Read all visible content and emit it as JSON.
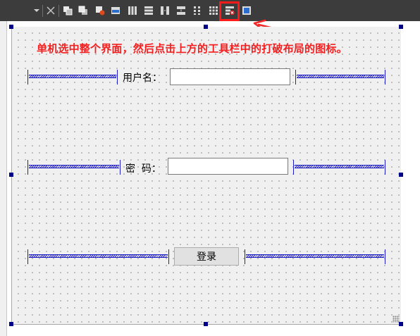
{
  "toolbar": {
    "icons": [
      "dropdown-arrow-icon",
      "close-icon",
      "send-to-back-icon",
      "bring-to-front-icon",
      "edit-tab-order-icon",
      "edit-buddies-icon",
      "layout-horizontal-icon",
      "layout-vertical-icon",
      "layout-horizontal-splitter-icon",
      "layout-vertical-splitter-icon",
      "layout-form-icon",
      "layout-grid-icon",
      "break-layout-icon",
      "adjust-size-icon"
    ],
    "highlighted": "break-layout-icon",
    "highlight_color": "#ff1a1a"
  },
  "instruction": {
    "text": "单机选中整个界面，然后点击上方的工具栏中的打破布局的图标。",
    "color": "#f22020"
  },
  "form": {
    "username_label": "用户名：",
    "password_label": "密  码：",
    "username_value": "",
    "password_value": "",
    "login_button": "登录",
    "handle_color": "#00008b",
    "spacer_color": "#1e1ec8"
  }
}
